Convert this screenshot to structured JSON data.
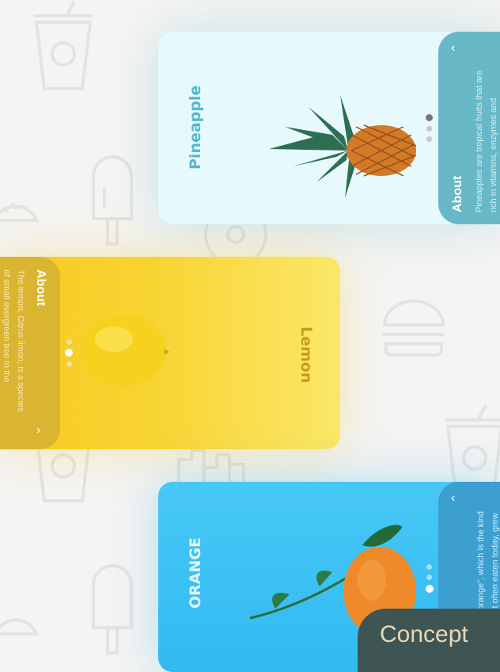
{
  "cards": {
    "pineapple": {
      "title": "Pineapple",
      "about_label": "About",
      "description_lines": [
        "Pineapples are tropical fruits that are",
        "rich in vitamins, enzymes and"
      ],
      "back_icon": "chevron-left-icon"
    },
    "lemon": {
      "title": "Lemon",
      "about_label": "About",
      "description_lines": [
        "The lemon, Citrus limon, is a species",
        "of small evergreen tree in the"
      ],
      "next_icon": "chevron-right-icon"
    },
    "orange": {
      "title": "ORANGE",
      "description_lines": [
        "orange\", which is the kind",
        "it often eaten today, grew"
      ],
      "back_icon": "chevron-left-icon"
    }
  },
  "badge": {
    "label": "Concept"
  },
  "colors": {
    "pineapple_bg": "#e6fafe",
    "pineapple_panel": "#68b8c7",
    "lemon_bg": "#f8d432",
    "lemon_panel": "#d9b532",
    "orange_bg": "#3cc3f4",
    "orange_panel": "#3c9fd0",
    "badge_bg": "#3e5553",
    "badge_text": "#e8d9b7"
  },
  "background_icons": [
    "cup-icon",
    "taco-icon",
    "popsicle-icon",
    "burger-icon",
    "donut-icon",
    "city-icon"
  ]
}
